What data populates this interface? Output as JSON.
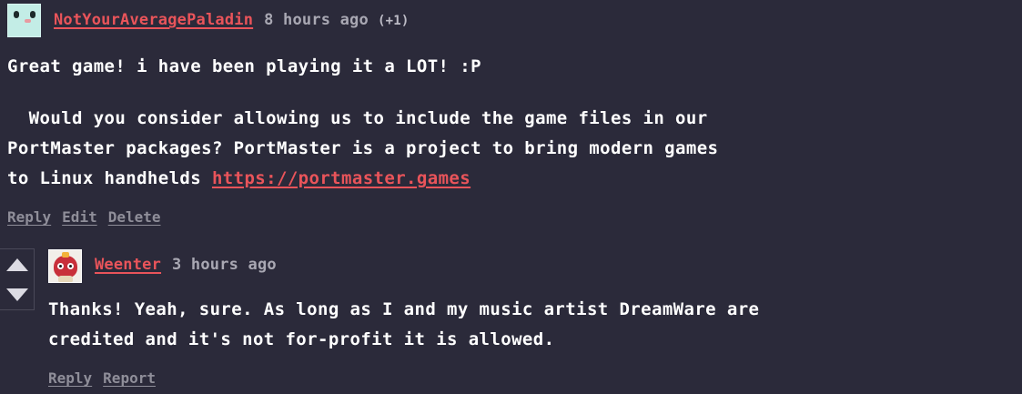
{
  "comments": [
    {
      "author": "NotYourAveragePaladin",
      "time": "8 hours ago",
      "votes": "(+1)",
      "lines": [
        "Great game! i have been playing it a LOT! :P",
        "",
        "  Would you consider allowing us to include the game files in our",
        "PortMaster packages? PortMaster is a project to bring modern games"
      ],
      "last_line_prefix": "to Linux handhelds ",
      "link": "https://portmaster.games",
      "actions": [
        "Reply",
        "Edit",
        "Delete"
      ]
    },
    {
      "author": "Weenter",
      "time": "3 hours ago",
      "lines": [
        "Thanks! Yeah, sure. As long as I and my music artist DreamWare are",
        "credited and it's not for-profit it is allowed."
      ],
      "actions": [
        "Reply",
        "Report"
      ]
    }
  ]
}
